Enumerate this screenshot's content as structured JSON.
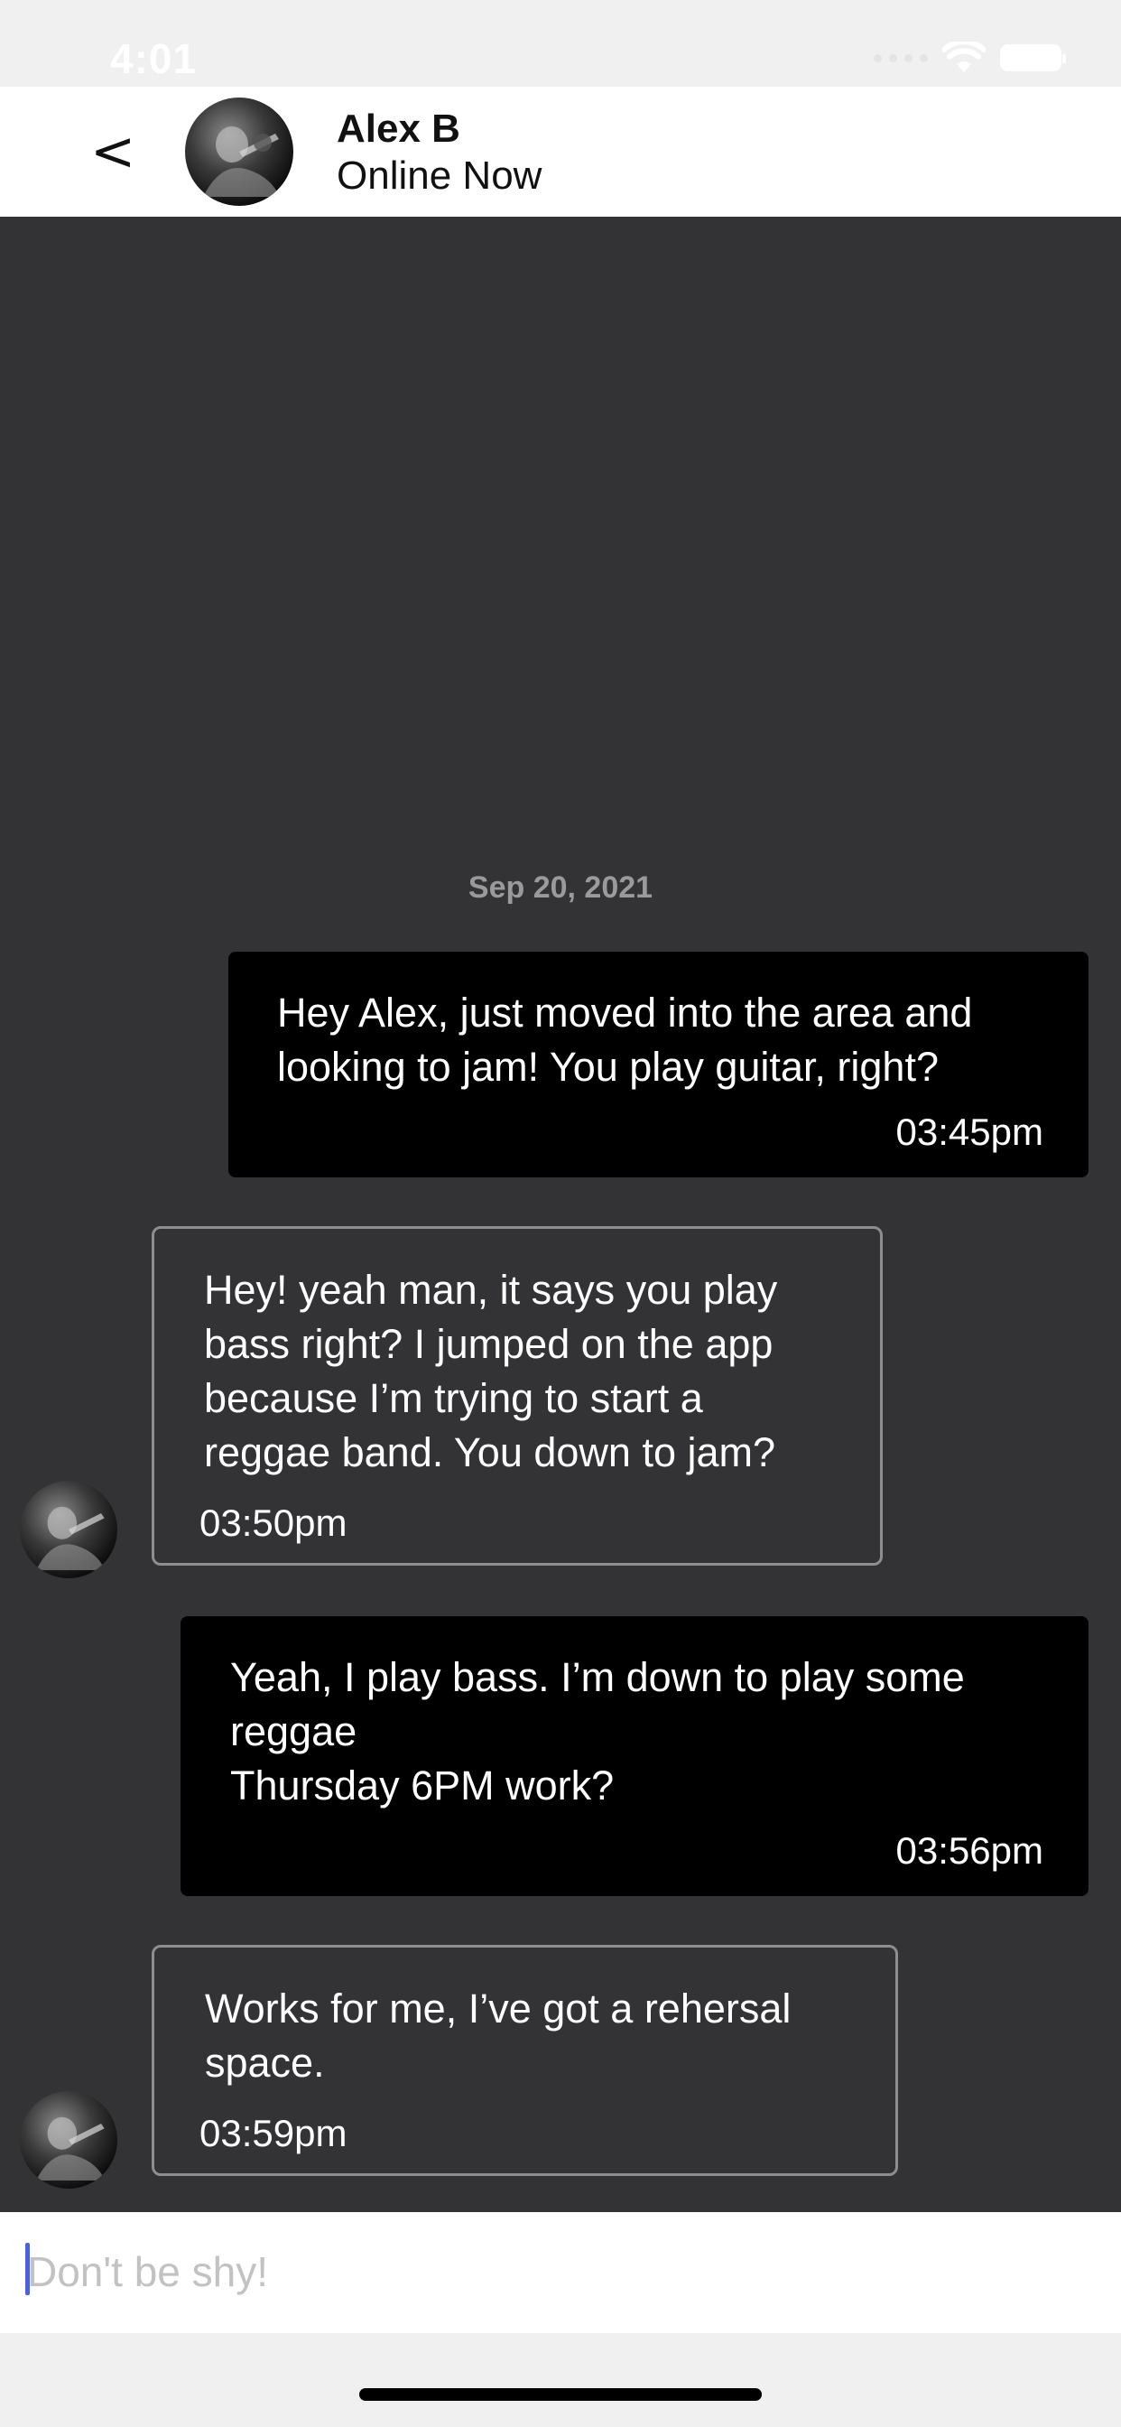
{
  "status_bar": {
    "time": "4:01"
  },
  "header": {
    "back_icon": "<",
    "contact_name": "Alex B",
    "contact_status": "Online Now"
  },
  "conversation": {
    "date_separator": "Sep 20, 2021",
    "messages": [
      {
        "direction": "sent",
        "text": "Hey Alex, just moved into the area and\nlooking to jam!  You play guitar, right?",
        "time": "03:45pm"
      },
      {
        "direction": "received",
        "text": "Hey! yeah man, it says you play\nbass right? I jumped on the app\nbecause I’m trying to start a\nreggae band. You down to jam?",
        "time": "03:50pm"
      },
      {
        "direction": "sent",
        "text": "Yeah, I play bass.  I’m down to play some\nreggae\nThursday 6PM work?",
        "time": "03:56pm"
      },
      {
        "direction": "received",
        "text": "Works for me, I’ve got a rehersal\nspace.",
        "time": "03:59pm"
      }
    ]
  },
  "composer": {
    "placeholder": "Don't be shy!",
    "value": ""
  },
  "colors": {
    "chat_background": "#333336",
    "sent_bubble": "#000000",
    "received_border": "#8e8e90",
    "header_background": "#ffffff",
    "caret": "#4b5fe0"
  }
}
